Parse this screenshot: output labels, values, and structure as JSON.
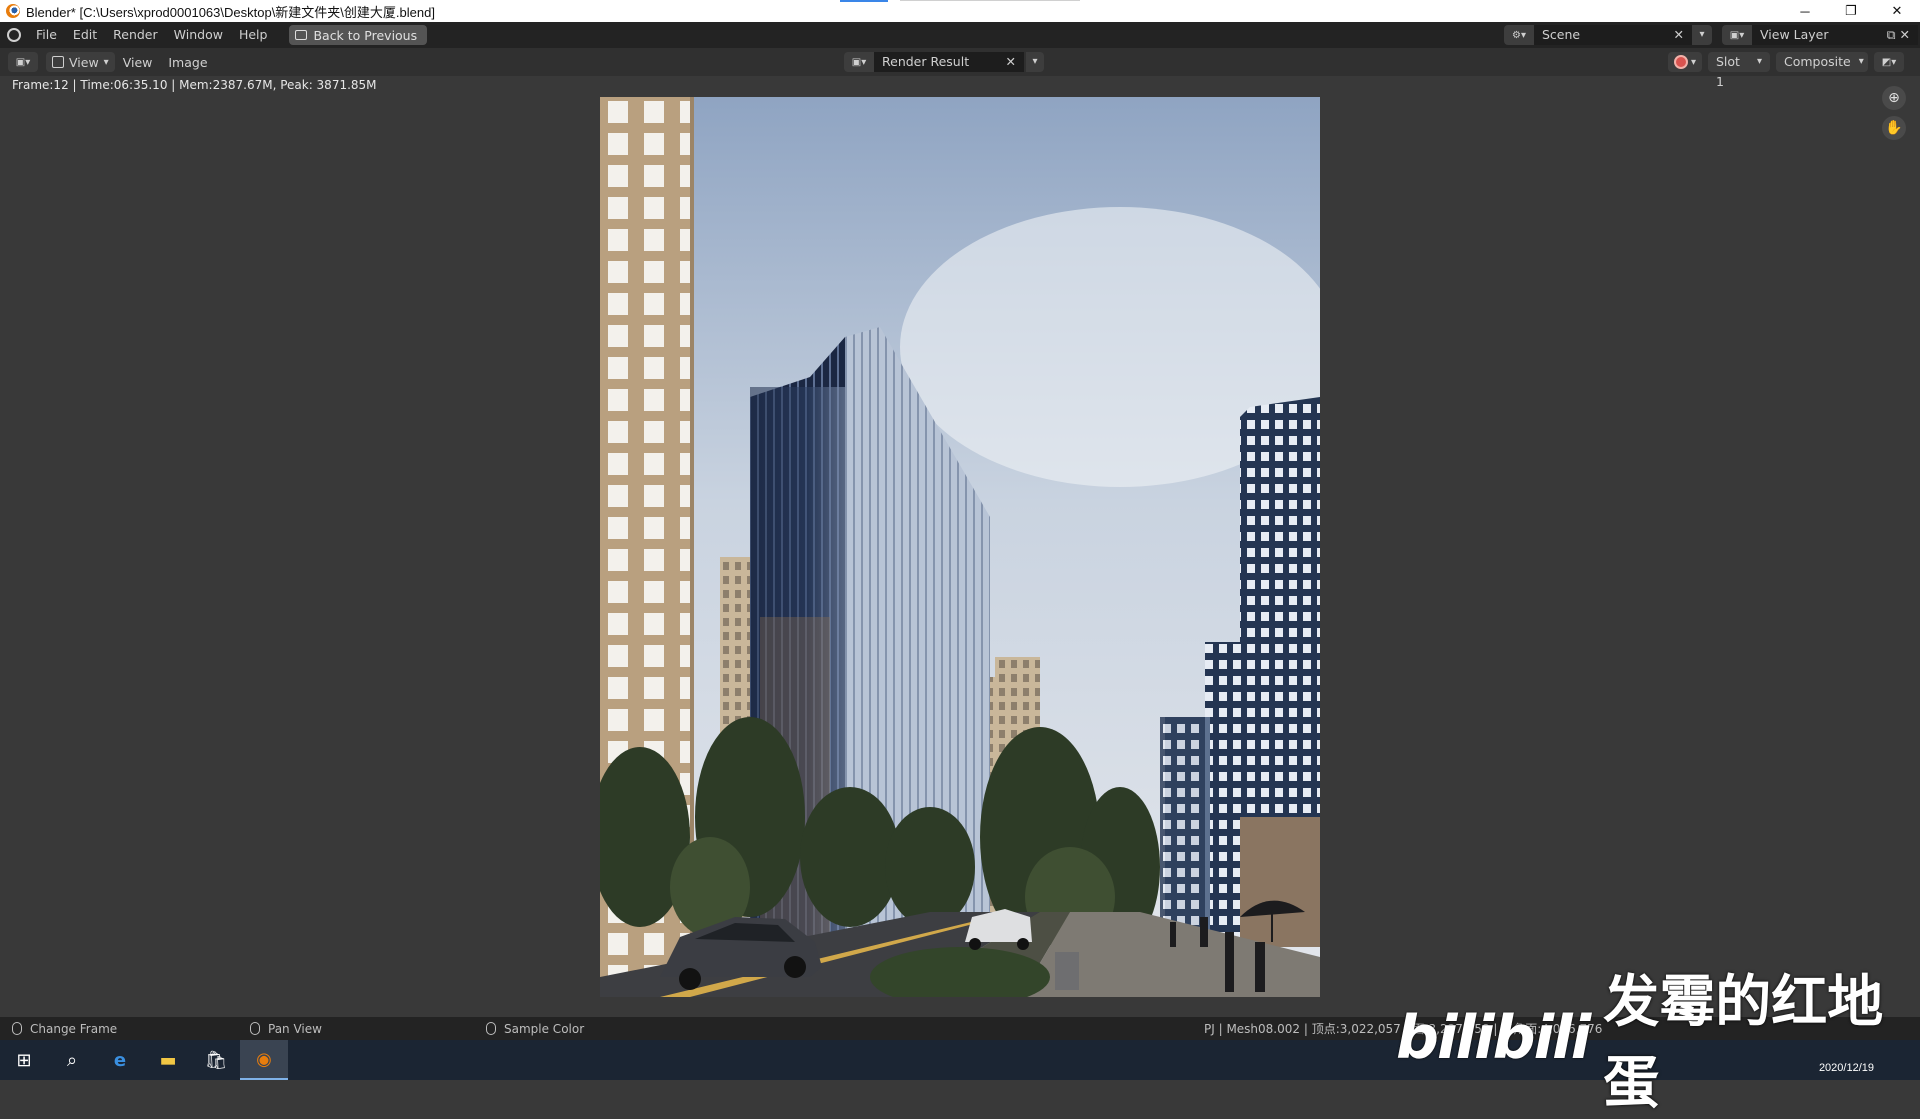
{
  "window": {
    "title": "Blender* [C:\\Users\\xprod0001063\\Desktop\\新建文件夹\\创建大厦.blend]",
    "minimize": "─",
    "restore": "❐",
    "close": "✕"
  },
  "menubar": {
    "items": [
      "File",
      "Edit",
      "Render",
      "Window",
      "Help"
    ],
    "back_button": "Back to Previous",
    "scene_label": "Scene",
    "view_layer_label": "View Layer"
  },
  "editor_header": {
    "view_mode": "View",
    "menus": [
      "View",
      "Image"
    ],
    "image_name": "Render Result",
    "slot": "Slot 1",
    "pass": "Composite"
  },
  "render_info": "Frame:12 | Time:06:35.10 | Mem:2387.67M, Peak: 3871.85M",
  "statusbar": {
    "hint_change_frame": "Change Frame",
    "hint_pan_view": "Pan View",
    "hint_sample_color": "Sample Color",
    "stats": "PJ | Mesh08.002 | 顶点:3,022,057 | 面:3,237,758 | 三角面:4,006,776"
  },
  "taskbar": {
    "clock_date": "2020/12/19"
  },
  "watermark": {
    "brand": "bilibili",
    "username": "发霉的红地蛋"
  },
  "colors": {
    "record_button": "#d9534f",
    "taskbar": "#1b2533",
    "accent": "#3a86e8"
  }
}
